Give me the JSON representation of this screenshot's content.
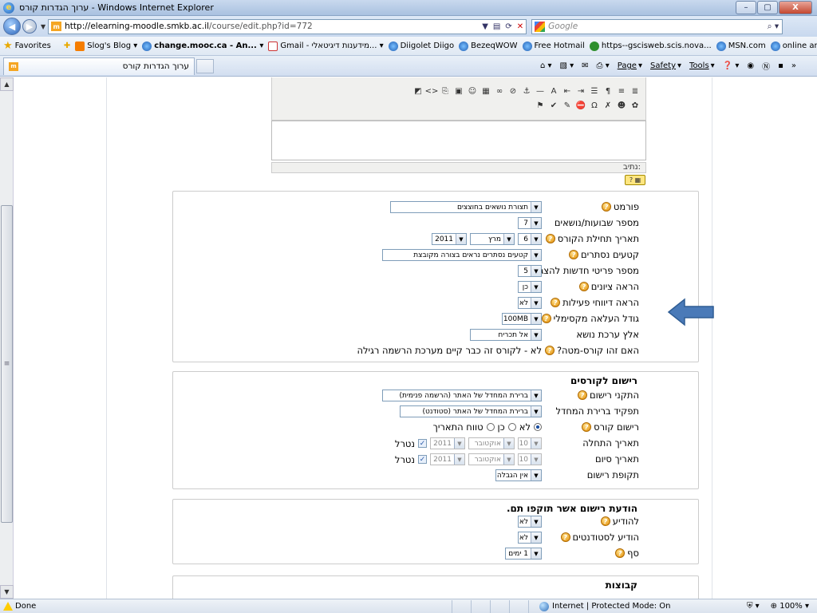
{
  "window": {
    "title": "ערוך הגדרות קורס - Windows Internet Explorer",
    "buttons": {
      "minimize": "–",
      "maximize": "▢",
      "close": "X"
    }
  },
  "address": {
    "url_host": "http://elearning-moodle.smkb.ac.il",
    "url_path": "/course/edit.php?id=772",
    "search_placeholder": "Google"
  },
  "favorites": {
    "label": "Favorites",
    "items": [
      {
        "label": "Slog's Blog ▾",
        "icon": "blogger-icon",
        "bold": false
      },
      {
        "label": "change.mooc.ca - An... ▾",
        "icon": "ie-page-icon",
        "bold": true
      },
      {
        "label": "Gmail - מידענות דיגיטאלי... ▾",
        "icon": "gmail-icon",
        "bold": false
      },
      {
        "label": "Diigolet Diigo",
        "icon": "ie-page-icon",
        "bold": false
      },
      {
        "label": "BezeqWOW",
        "icon": "ie-page-icon",
        "bold": false
      },
      {
        "label": "Free Hotmail",
        "icon": "ie-page-icon",
        "bold": false
      },
      {
        "label": "https--gscisweb.scis.nova...",
        "icon": "web-icon",
        "bold": false
      },
      {
        "label": "MSN.com",
        "icon": "ie-page-icon",
        "bold": false
      },
      {
        "label": "online articles",
        "icon": "ie-page-icon",
        "bold": false
      }
    ],
    "more": "»"
  },
  "tabs": {
    "active": "ערוך הגדרות קורס"
  },
  "command_bar": {
    "page": "Page",
    "safety": "Safety",
    "tools": "Tools",
    "more": "»"
  },
  "editor": {
    "path_label": "נתיב:"
  },
  "form": {
    "rows": [
      {
        "label": "פורמט",
        "help": true,
        "value": "תצורת נושאים בחוצצים",
        "width": 190
      },
      {
        "label": "מספר שבועות/נושאים",
        "help": false,
        "value": "7",
        "width": 30
      },
      {
        "label": "תאריך תחילת הקורס",
        "help": true,
        "date": {
          "day": "6",
          "month": "מרץ",
          "year": "2011"
        }
      },
      {
        "label": "קטעים נסתרים",
        "help": true,
        "value": "קטעים נסתרים נראים בצורה מקובצת",
        "width": 200
      },
      {
        "label": "מספר פריטי חדשות להצגה",
        "help": true,
        "value": "5",
        "width": 30
      },
      {
        "label": "הראה ציונים",
        "help": true,
        "value": "כן",
        "width": 30
      },
      {
        "label": "הראה דיווחי פעילות",
        "help": true,
        "value": "לא",
        "width": 30
      },
      {
        "label": "גודל העלאה מקסימלי",
        "help": true,
        "value": "100MB",
        "width": 50
      },
      {
        "label": "אלץ ערכת נושא",
        "help": false,
        "value": "אל תכריח",
        "width": 90
      },
      {
        "label": "האם זהו קורס-מטה?",
        "help": true,
        "text": "לא - לקורס זה כבר קיים מערכת הרשמה רגילה"
      }
    ],
    "enrol": {
      "legend": "רישום לקורסים",
      "rows": [
        {
          "label": "התקני רישום",
          "help": true,
          "value": "ברירת המחדל של האתר (הרשמה פנימית)"
        },
        {
          "label": "תפקיד ברירת המחדל",
          "help": false,
          "value": "ברירת המחדל של האתר (סטודנט)"
        },
        {
          "label": "רישום קורס",
          "help": true,
          "radio": [
            "לא",
            "כן",
            "טווח התאריך"
          ]
        },
        {
          "label": "תאריך התחלה",
          "help": false,
          "date": {
            "day": "10",
            "month": "אוקטובר",
            "year": "2011"
          },
          "disabled_label": "נטרל"
        },
        {
          "label": "תאריך סיום",
          "help": false,
          "date": {
            "day": "10",
            "month": "אוקטובר",
            "year": "2011"
          },
          "disabled_label": "נטרל"
        },
        {
          "label": "תקופת רישום",
          "help": false,
          "value": "אין הגבלה"
        }
      ]
    },
    "expiry": {
      "legend": "הודעת רישום אשר תוקפו תם.",
      "rows": [
        {
          "label": "להודיע",
          "help": true,
          "value": "לא"
        },
        {
          "label": "הודיע לסטודנטים",
          "help": true,
          "value": "לא"
        },
        {
          "label": "סף",
          "help": true,
          "value": "1 ימים"
        }
      ]
    },
    "groups": {
      "legend": "קבוצות"
    }
  },
  "status": {
    "left": "Done",
    "zone": "Internet | Protected Mode: On",
    "zoom": "100%"
  },
  "colors": {
    "arrow": "#4a7ab8",
    "arrow_stroke": "#2f5d94"
  }
}
